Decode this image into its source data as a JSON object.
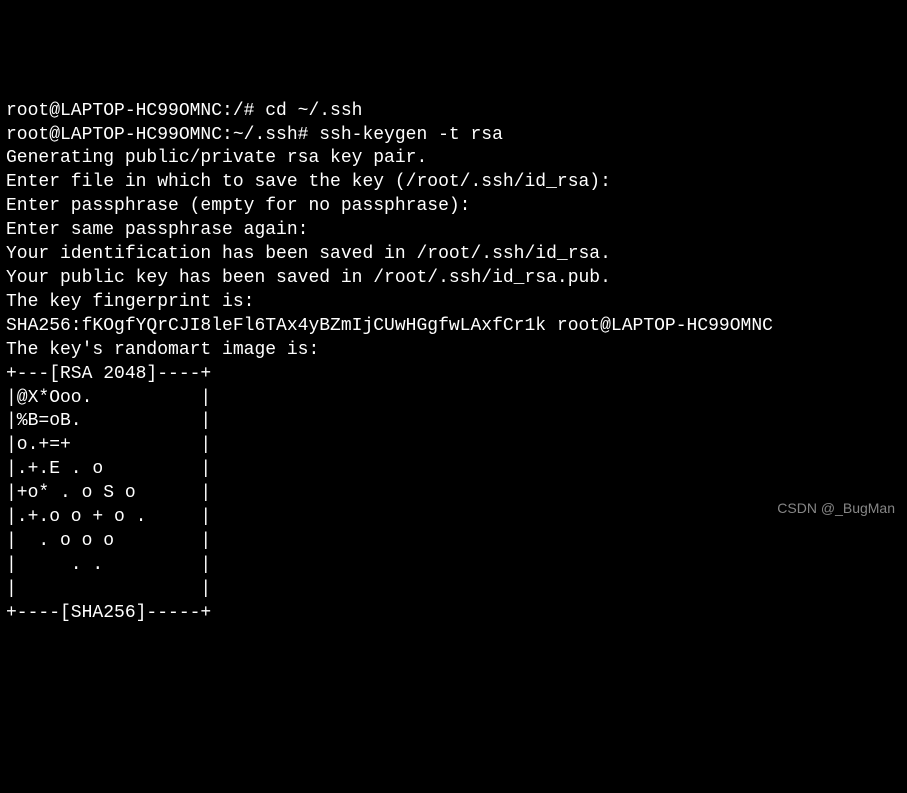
{
  "terminal": {
    "lines": [
      "root@LAPTOP-HC99OMNC:/# cd ~/.ssh",
      "root@LAPTOP-HC99OMNC:~/.ssh# ssh-keygen -t rsa",
      "Generating public/private rsa key pair.",
      "Enter file in which to save the key (/root/.ssh/id_rsa):",
      "Enter passphrase (empty for no passphrase):",
      "Enter same passphrase again:",
      "Your identification has been saved in /root/.ssh/id_rsa.",
      "Your public key has been saved in /root/.ssh/id_rsa.pub.",
      "The key fingerprint is:",
      "SHA256:fKOgfYQrCJI8leFl6TAx4yBZmIjCUwHGgfwLAxfCr1k root@LAPTOP-HC99OMNC",
      "The key's randomart image is:",
      "+---[RSA 2048]----+",
      "|@X*Ooo.          |",
      "|%B=oB.           |",
      "|o.+=+            |",
      "|.+.E . o         |",
      "|+o* . o S o      |",
      "|.+.o o + o .     |",
      "|  . o o o        |",
      "|     . .         |",
      "|                 |",
      "+----[SHA256]-----+"
    ]
  },
  "watermark": "CSDN @_BugMan"
}
